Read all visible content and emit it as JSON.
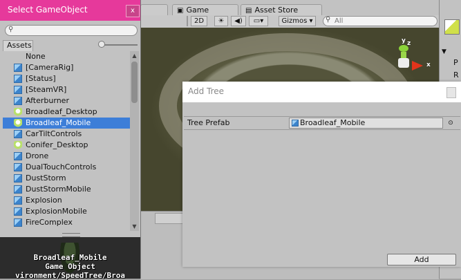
{
  "editor": {
    "tabs": [
      {
        "label": "Game",
        "icon": "game-icon"
      },
      {
        "label": "Asset Store",
        "icon": "asset-store-icon"
      }
    ],
    "toolbar": {
      "mode_2d": "2D",
      "gizmos": "Gizmos",
      "search_placeholder": "All"
    },
    "gizmo": {
      "y": "y",
      "z": "z",
      "x": "x"
    },
    "inspector_fragments": [
      "P",
      "R"
    ]
  },
  "select_window": {
    "title": "Select GameObject",
    "close_label": "x",
    "search_value": "",
    "assets_tab": "Assets",
    "zoom_level": 0.0,
    "items": [
      {
        "label": "None",
        "icon": "none"
      },
      {
        "label": "[CameraRig]",
        "icon": "prefab-cube-icon"
      },
      {
        "label": "[Status]",
        "icon": "prefab-cube-icon"
      },
      {
        "label": "[SteamVR]",
        "icon": "prefab-cube-icon"
      },
      {
        "label": "Afterburner",
        "icon": "prefab-cube-icon"
      },
      {
        "label": "Broadleaf_Desktop",
        "icon": "speedtree-icon"
      },
      {
        "label": "Broadleaf_Mobile",
        "icon": "speedtree-icon",
        "selected": true
      },
      {
        "label": "CarTiltControls",
        "icon": "prefab-cube-icon"
      },
      {
        "label": "Conifer_Desktop",
        "icon": "speedtree-icon"
      },
      {
        "label": "Drone",
        "icon": "prefab-cube-icon"
      },
      {
        "label": "DualTouchControls",
        "icon": "prefab-cube-icon"
      },
      {
        "label": "DustStorm",
        "icon": "prefab-cube-icon"
      },
      {
        "label": "DustStormMobile",
        "icon": "prefab-cube-icon"
      },
      {
        "label": "Explosion",
        "icon": "prefab-cube-icon"
      },
      {
        "label": "ExplosionMobile",
        "icon": "prefab-cube-icon"
      },
      {
        "label": "FireComplex",
        "icon": "prefab-cube-icon"
      }
    ],
    "preview": {
      "name": "Broadleaf_Mobile",
      "type": "Game Object",
      "path": "vironment/SpeedTree/Broa"
    }
  },
  "add_tree": {
    "title": "Add Tree",
    "field_label": "Tree Prefab",
    "field_value": "Broadleaf_Mobile",
    "add_label": "Add"
  }
}
